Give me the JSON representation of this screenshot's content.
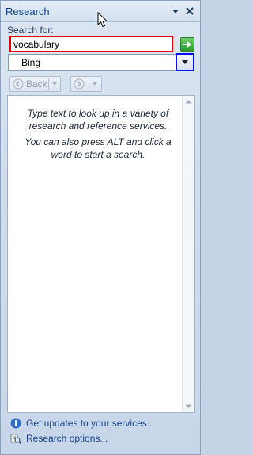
{
  "panel": {
    "title": "Research"
  },
  "search": {
    "label": "Search for:",
    "value": "vocabulary",
    "service": "Bing"
  },
  "nav": {
    "back_label": "Back"
  },
  "results": {
    "message_1": "Type text to look up in a variety of research and reference services.",
    "message_2": "You can also press ALT and click a word to start a search."
  },
  "footer": {
    "updates_link": "Get updates to your services...",
    "options_link": "Research options..."
  },
  "colors": {
    "search_highlight": "#e00000",
    "dropdown_highlight": "#0011ee",
    "link": "#15428b"
  }
}
